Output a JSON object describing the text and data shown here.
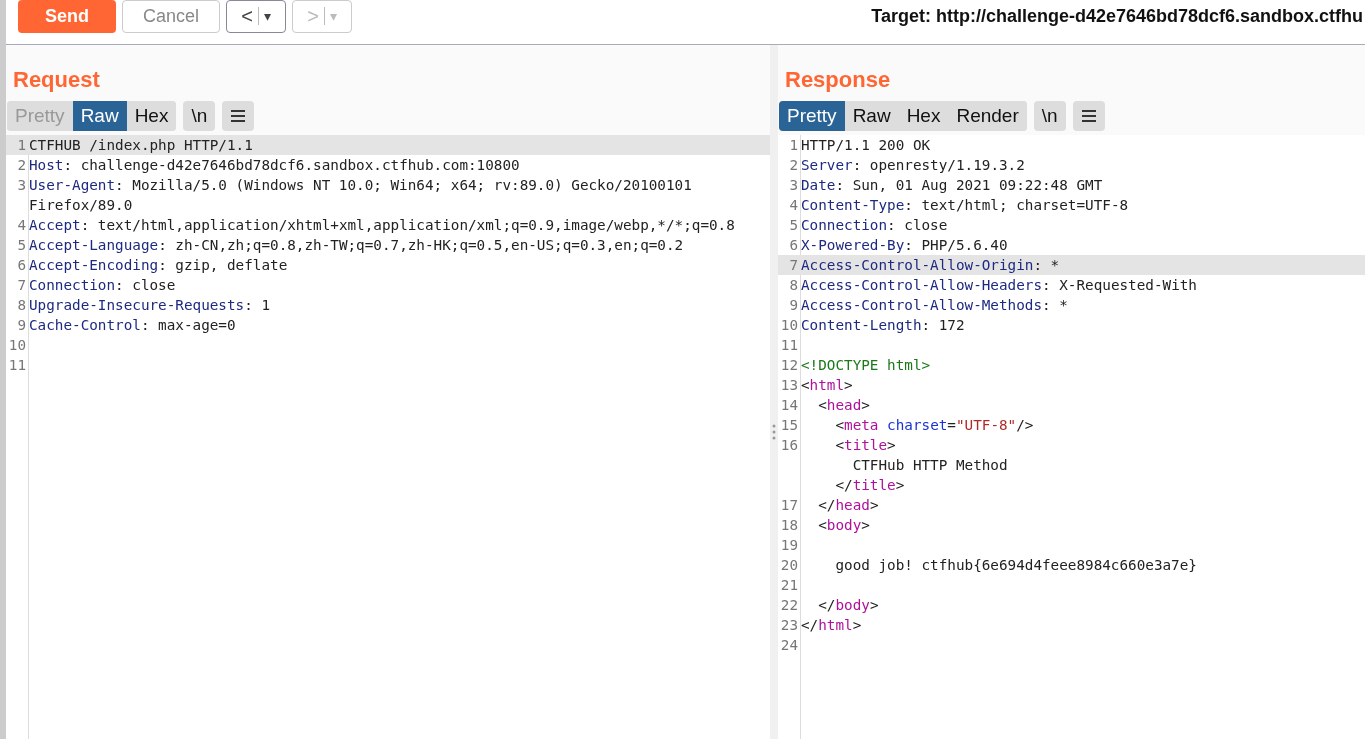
{
  "toolbar": {
    "send": "Send",
    "cancel": "Cancel",
    "nav_buttons": [
      {
        "icon": "<",
        "menu": "▾",
        "disabled": false
      },
      {
        "icon": ">",
        "menu": "▾",
        "disabled": true
      }
    ],
    "target": "Target: http://challenge-d42e7646bd78dcf6.sandbox.ctfhu"
  },
  "panels": [
    {
      "title": "Request",
      "tabs": [
        {
          "label": "Pretty",
          "selected": false,
          "disabled": true
        },
        {
          "label": "Raw",
          "selected": true,
          "disabled": false
        },
        {
          "label": "Hex",
          "selected": false,
          "disabled": false
        }
      ],
      "newline_button": "\\n",
      "lines": [
        {
          "number": "1",
          "selected": true,
          "segments": [
            {
              "kind": "plain",
              "text": "CTFHUB /index.php HTTP/1.1"
            }
          ]
        },
        {
          "number": "2",
          "selected": false,
          "segments": [
            {
              "kind": "key",
              "text": "Host"
            },
            {
              "kind": "plain",
              "text": ": challenge-d42e7646bd78dcf6.sandbox.ctfhub.com:10800"
            }
          ]
        },
        {
          "number": "3",
          "selected": false,
          "segments": [
            {
              "kind": "key",
              "text": "User-Agent"
            },
            {
              "kind": "plain",
              "text": ": Mozilla/5.0 (Windows NT 10.0; Win64; x64; rv:89.0) Gecko/20100101"
            }
          ]
        },
        {
          "selected": false,
          "segments": [
            {
              "kind": "plain",
              "text": "Firefox/89.0"
            }
          ]
        },
        {
          "number": "4",
          "selected": false,
          "segments": [
            {
              "kind": "key",
              "text": "Accept"
            },
            {
              "kind": "plain",
              "text": ": text/html,application/xhtml+xml,application/xml;q=0.9,image/webp,*/*;q=0.8"
            }
          ]
        },
        {
          "number": "5",
          "selected": false,
          "segments": [
            {
              "kind": "key",
              "text": "Accept-Language"
            },
            {
              "kind": "plain",
              "text": ": zh-CN,zh;q=0.8,zh-TW;q=0.7,zh-HK;q=0.5,en-US;q=0.3,en;q=0.2"
            }
          ]
        },
        {
          "number": "6",
          "selected": false,
          "segments": [
            {
              "kind": "key",
              "text": "Accept-Encoding"
            },
            {
              "kind": "plain",
              "text": ": gzip, deflate"
            }
          ]
        },
        {
          "number": "7",
          "selected": false,
          "segments": [
            {
              "kind": "key",
              "text": "Connection"
            },
            {
              "kind": "plain",
              "text": ": close"
            }
          ]
        },
        {
          "number": "8",
          "selected": false,
          "segments": [
            {
              "kind": "key",
              "text": "Upgrade-Insecure-Requests"
            },
            {
              "kind": "plain",
              "text": ": 1"
            }
          ]
        },
        {
          "number": "9",
          "selected": false,
          "segments": [
            {
              "kind": "key",
              "text": "Cache-Control"
            },
            {
              "kind": "plain",
              "text": ": max-age=0"
            }
          ]
        },
        {
          "number": "10",
          "selected": false
        },
        {
          "number": "11",
          "selected": false
        }
      ]
    },
    {
      "title": "Response",
      "tabs": [
        {
          "label": "Pretty",
          "selected": true,
          "disabled": false
        },
        {
          "label": "Raw",
          "selected": false,
          "disabled": false
        },
        {
          "label": "Hex",
          "selected": false,
          "disabled": false
        },
        {
          "label": "Render",
          "selected": false,
          "disabled": false
        }
      ],
      "newline_button": "\\n",
      "lines": [
        {
          "number": "1",
          "selected": false,
          "segments": [
            {
              "kind": "plain",
              "text": "HTTP/1.1 200 OK"
            }
          ]
        },
        {
          "number": "2",
          "selected": false,
          "segments": [
            {
              "kind": "key",
              "text": "Server"
            },
            {
              "kind": "plain",
              "text": ": openresty/1.19.3.2"
            }
          ]
        },
        {
          "number": "3",
          "selected": false,
          "segments": [
            {
              "kind": "key",
              "text": "Date"
            },
            {
              "kind": "plain",
              "text": ": Sun, 01 Aug 2021 09:22:48 GMT"
            }
          ]
        },
        {
          "number": "4",
          "selected": false,
          "segments": [
            {
              "kind": "key",
              "text": "Content-Type"
            },
            {
              "kind": "plain",
              "text": ": text/html; charset=UTF-8"
            }
          ]
        },
        {
          "number": "5",
          "selected": false,
          "segments": [
            {
              "kind": "key",
              "text": "Connection"
            },
            {
              "kind": "plain",
              "text": ": close"
            }
          ]
        },
        {
          "number": "6",
          "selected": false,
          "segments": [
            {
              "kind": "key",
              "text": "X-Powered-By"
            },
            {
              "kind": "plain",
              "text": ": PHP/5.6.40"
            }
          ]
        },
        {
          "number": "7",
          "selected": true,
          "segments": [
            {
              "kind": "key",
              "text": "Access-Control-Allow-Origin"
            },
            {
              "kind": "plain",
              "text": ": *"
            }
          ]
        },
        {
          "number": "8",
          "selected": false,
          "segments": [
            {
              "kind": "key",
              "text": "Access-Control-Allow-Headers"
            },
            {
              "kind": "plain",
              "text": ": X-Requested-With"
            }
          ]
        },
        {
          "number": "9",
          "selected": false,
          "segments": [
            {
              "kind": "key",
              "text": "Access-Control-Allow-Methods"
            },
            {
              "kind": "plain",
              "text": ": *"
            }
          ]
        },
        {
          "number": "10",
          "selected": false,
          "segments": [
            {
              "kind": "key",
              "text": "Content-Length"
            },
            {
              "kind": "plain",
              "text": ": 172"
            }
          ]
        },
        {
          "number": "11",
          "selected": false
        },
        {
          "number": "12",
          "selected": false,
          "segments": [
            {
              "kind": "doctype",
              "text": "<!DOCTYPE html>"
            }
          ]
        },
        {
          "number": "13",
          "selected": false,
          "segments": [
            {
              "kind": "plain",
              "text": "<"
            },
            {
              "kind": "tag",
              "text": "html"
            },
            {
              "kind": "plain",
              "text": ">"
            }
          ]
        },
        {
          "number": "14",
          "selected": false,
          "segments": [
            {
              "kind": "plain",
              "text": "  <"
            },
            {
              "kind": "tag",
              "text": "head"
            },
            {
              "kind": "plain",
              "text": ">"
            }
          ]
        },
        {
          "number": "15",
          "selected": false,
          "segments": [
            {
              "kind": "plain",
              "text": "    <"
            },
            {
              "kind": "tag",
              "text": "meta"
            },
            {
              "kind": "attr",
              "text": " charset"
            },
            {
              "kind": "plain",
              "text": "="
            },
            {
              "kind": "string",
              "text": "\"UTF-8\""
            },
            {
              "kind": "plain",
              "text": "/>"
            }
          ]
        },
        {
          "number": "16",
          "selected": false,
          "segments": [
            {
              "kind": "plain",
              "text": "    <"
            },
            {
              "kind": "tag",
              "text": "title"
            },
            {
              "kind": "plain",
              "text": ">"
            }
          ]
        },
        {
          "selected": false,
          "segments": [
            {
              "kind": "plain",
              "text": "      CTFHub HTTP Method"
            }
          ]
        },
        {
          "selected": false,
          "segments": [
            {
              "kind": "plain",
              "text": "    </"
            },
            {
              "kind": "tag",
              "text": "title"
            },
            {
              "kind": "plain",
              "text": ">"
            }
          ]
        },
        {
          "number": "17",
          "selected": false,
          "segments": [
            {
              "kind": "plain",
              "text": "  </"
            },
            {
              "kind": "tag",
              "text": "head"
            },
            {
              "kind": "plain",
              "text": ">"
            }
          ]
        },
        {
          "number": "18",
          "selected": false,
          "segments": [
            {
              "kind": "plain",
              "text": "  <"
            },
            {
              "kind": "tag",
              "text": "body"
            },
            {
              "kind": "plain",
              "text": ">"
            }
          ]
        },
        {
          "number": "19",
          "selected": false
        },
        {
          "number": "20",
          "selected": false,
          "segments": [
            {
              "kind": "plain",
              "text": "    good job! ctfhub{6e694d4feee8984c660e3a7e}"
            }
          ]
        },
        {
          "number": "21",
          "selected": false
        },
        {
          "number": "22",
          "selected": false,
          "segments": [
            {
              "kind": "plain",
              "text": "  </"
            },
            {
              "kind": "tag",
              "text": "body"
            },
            {
              "kind": "plain",
              "text": ">"
            }
          ]
        },
        {
          "number": "23",
          "selected": false,
          "segments": [
            {
              "kind": "plain",
              "text": "</"
            },
            {
              "kind": "tag",
              "text": "html"
            },
            {
              "kind": "plain",
              "text": ">"
            }
          ]
        },
        {
          "number": "24",
          "selected": false
        }
      ]
    }
  ]
}
